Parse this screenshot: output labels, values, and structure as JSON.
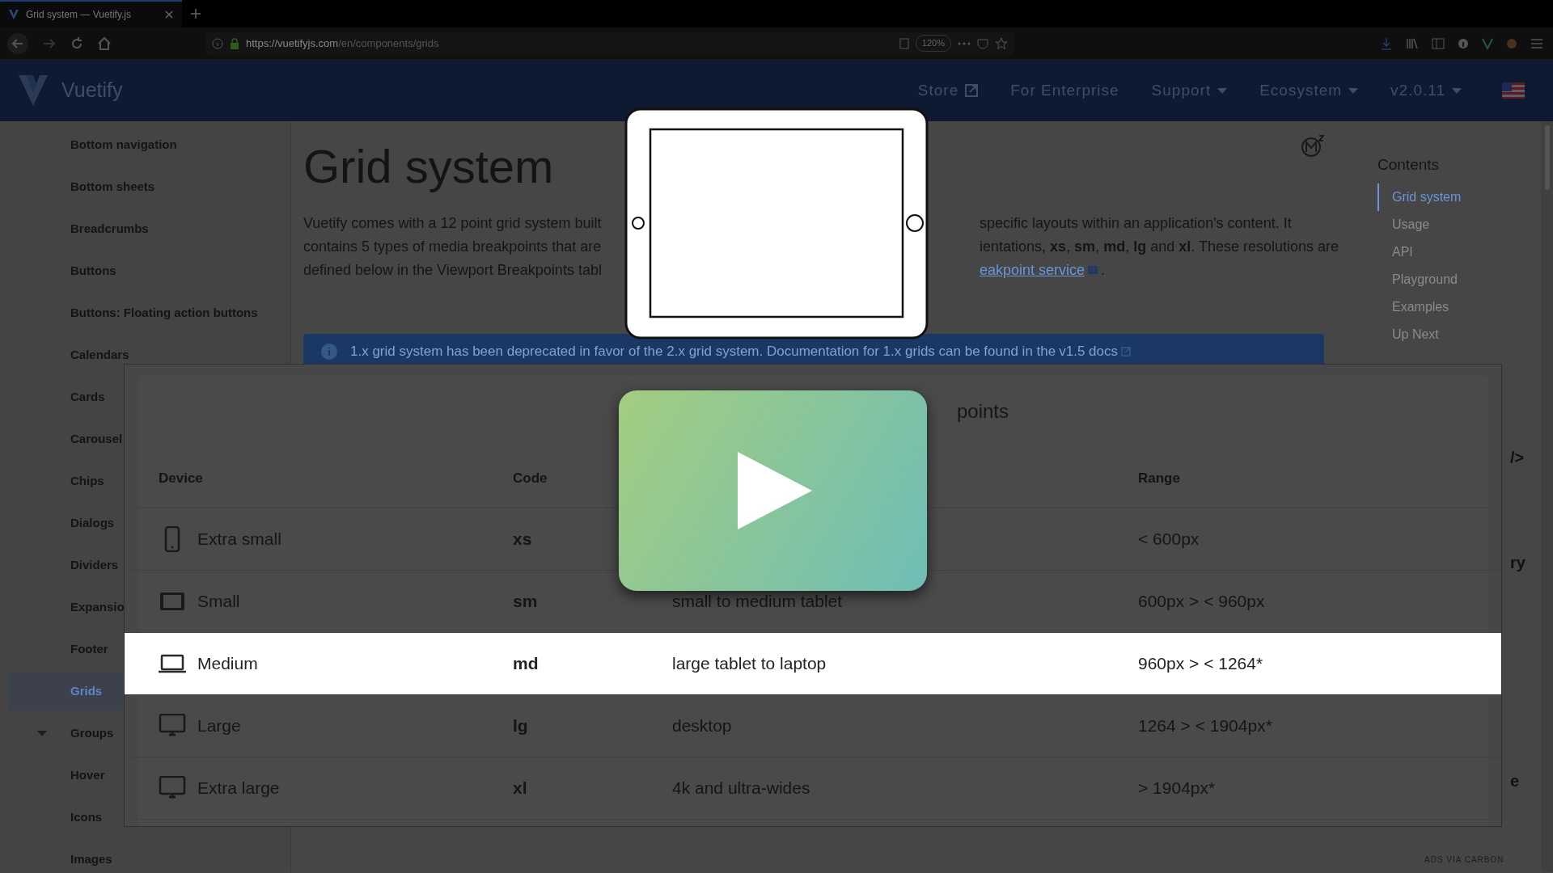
{
  "browser": {
    "tab_title": "Grid system — Vuetify.js",
    "url_host": "https://vuetifyjs.com",
    "url_path": "/en/components/grids",
    "zoom": "120%"
  },
  "app_bar": {
    "brand": "Vuetify",
    "items": [
      {
        "label": "Store",
        "kind": "external"
      },
      {
        "label": "For Enterprise",
        "kind": "plain"
      },
      {
        "label": "Support",
        "kind": "menu"
      },
      {
        "label": "Ecosystem",
        "kind": "menu"
      },
      {
        "label": "v2.0.11",
        "kind": "menu"
      }
    ]
  },
  "sidebar": {
    "items": [
      {
        "label": "Bottom navigation",
        "selected": false,
        "kind": "link"
      },
      {
        "label": "Bottom sheets",
        "selected": false,
        "kind": "link"
      },
      {
        "label": "Breadcrumbs",
        "selected": false,
        "kind": "link"
      },
      {
        "label": "Buttons",
        "selected": false,
        "kind": "link"
      },
      {
        "label": "Buttons: Floating action buttons",
        "selected": false,
        "kind": "link"
      },
      {
        "label": "Calendars",
        "selected": false,
        "kind": "link"
      },
      {
        "label": "Cards",
        "selected": false,
        "kind": "link"
      },
      {
        "label": "Carousel",
        "selected": false,
        "kind": "link"
      },
      {
        "label": "Chips",
        "selected": false,
        "kind": "link"
      },
      {
        "label": "Dialogs",
        "selected": false,
        "kind": "link"
      },
      {
        "label": "Dividers",
        "selected": false,
        "kind": "link"
      },
      {
        "label": "Expansio",
        "selected": false,
        "kind": "link"
      },
      {
        "label": "Footer",
        "selected": false,
        "kind": "link"
      },
      {
        "label": "Grids",
        "selected": true,
        "kind": "link"
      },
      {
        "label": "Groups",
        "selected": false,
        "kind": "group"
      },
      {
        "label": "Hover",
        "selected": false,
        "kind": "link"
      },
      {
        "label": "Icons",
        "selected": false,
        "kind": "link"
      },
      {
        "label": "Images",
        "selected": false,
        "kind": "link"
      }
    ]
  },
  "page": {
    "title": "Grid system",
    "intro": [
      {
        "left": "Vuetify comes with a 12 point grid system built",
        "right": "specific layouts within an application's content. It"
      },
      {
        "left": "contains 5 types of media breakpoints that are",
        "right": "ientations, **xs**, **sm**, **md**, **lg** and **xl**. These resolutions are"
      },
      {
        "left": "defined below in the Viewport Breakpoints tabl",
        "link": "eakpoint service",
        "after": "."
      }
    ],
    "alert": {
      "text": "1.x grid system has been deprecated in favor of the 2.x grid system. Documentation for 1.x grids can be found in the",
      "link": "v1.5 docs"
    }
  },
  "contents": {
    "heading": "Contents",
    "items": [
      {
        "label": "Grid system",
        "selected": true
      },
      {
        "label": "Usage",
        "selected": false
      },
      {
        "label": "API",
        "selected": false
      },
      {
        "label": "Playground",
        "selected": false
      },
      {
        "label": "Examples",
        "selected": false
      },
      {
        "label": "Up Next",
        "selected": false
      }
    ],
    "fragments": [
      "/>",
      "ry",
      "e"
    ],
    "ads": "ADS VIA CARBON"
  },
  "breakpoints": {
    "title": "points",
    "header": {
      "device": "Device",
      "code": "Code",
      "range": "Range"
    },
    "rows": [
      {
        "kind": "phone",
        "device": "Extra small",
        "code": "xs",
        "range": "< 600px",
        "selected": false
      },
      {
        "kind": "tablet",
        "device": "Small",
        "code": "sm",
        "description": "small to medium tablet",
        "range": "600px > < 960px",
        "selected": false
      },
      {
        "kind": "laptop",
        "device": "Medium",
        "code": "md",
        "description": "large tablet to laptop",
        "range": "960px > < 1264*",
        "selected": true
      },
      {
        "kind": "desktop",
        "device": "Large",
        "code": "lg",
        "description": "desktop",
        "range": "1264 > < 1904px*",
        "selected": false
      },
      {
        "kind": "desktop",
        "device": "Extra large",
        "code": "xl",
        "description": "4k and ultra-wides",
        "range": "> 1904px*",
        "selected": false
      }
    ]
  }
}
